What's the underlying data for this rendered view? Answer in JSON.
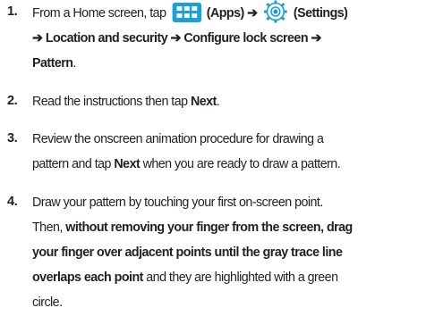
{
  "colors": {
    "text": "#231f20",
    "apps_icon_bg": "#1b9fd8",
    "settings_icon": "#1b9fd8"
  },
  "steps": [
    {
      "number": "1.",
      "text": {
        "a": "From a Home screen, tap ",
        "apps": "(Apps)",
        "arrow1": " ➔ ",
        "settings": "(Settings)",
        "arrow2": "➔ ",
        "location": "Location and security",
        "arrow3": " ➔ ",
        "configure": "Configure lock screen",
        "arrow4": " ➔",
        "pattern": "Pattern",
        "end": "."
      },
      "icons": [
        "apps-icon",
        "settings-icon"
      ]
    },
    {
      "number": "2.",
      "text": {
        "a": "Read the instructions then tap ",
        "next": "Next",
        "end": "."
      }
    },
    {
      "number": "3.",
      "text": {
        "line1": "Review the onscreen animation procedure for drawing a",
        "a": "pattern and tap ",
        "next": "Next",
        "b": " when you are ready to draw a pattern."
      }
    },
    {
      "number": "4.",
      "text": {
        "line1": "Draw your pattern by touching your first on-screen point.",
        "a": "Then, ",
        "bold1": "without removing your finger from the screen, drag",
        "bold2": "your finger over adjacent points until the gray trace line",
        "bold3": "overlaps each point",
        "b": " and they are highlighted with a green",
        "line5": "circle."
      }
    }
  ]
}
